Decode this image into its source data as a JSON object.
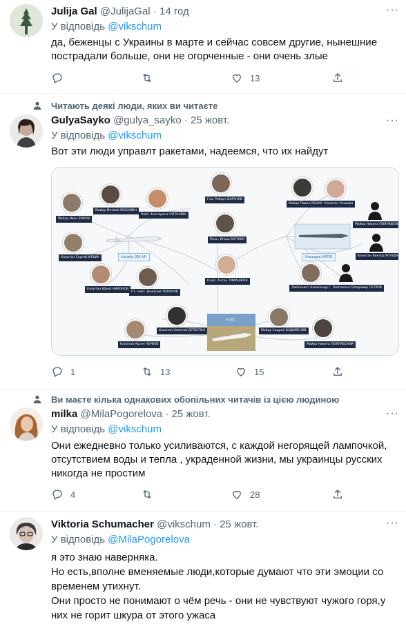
{
  "tweets": {
    "t1": {
      "name": "Julija Gal",
      "handle": "@JulijaGal",
      "date": "14 год",
      "reply_prefix": "У відповідь",
      "reply_to": "@vikschum",
      "lines": [
        "да, беженцы с Украины в марте и сейчас совсем другие, нынешние",
        "пострадали больше, они не огорченные - они очень злые"
      ],
      "replies": "",
      "retweets": "",
      "likes": "13"
    },
    "t2": {
      "social_context": "Читають деякі люди, яких ви читаєте",
      "name": "GulyaSayko",
      "handle": "@gulya_sayko",
      "date": "25 жовт.",
      "reply_prefix": "У відповідь",
      "reply_to": "@vikschum",
      "lines": [
        "Вот эти люди управлт ракетами, надеемся, что их найдут"
      ],
      "replies": "1",
      "retweets": "13",
      "likes": "15"
    },
    "t3": {
      "social_context": "Ви маєте кілька однакових обопільних читачів із цією людиною",
      "name": "milka",
      "handle": "@MilaPogorelova",
      "date": "25 жовт.",
      "reply_prefix": "У відповідь",
      "reply_to": "@vikschum",
      "lines": [
        "Они ежедневно только усиливаются, с каждой негорящей лампочкой,",
        "отсутствием воды и тепла , украденной жизни, мы украинцы русских",
        "никогда не простим"
      ],
      "replies": "4",
      "retweets": "",
      "likes": "28"
    },
    "t4": {
      "name": "Viktoria Schumacher",
      "handle": "@vikschum",
      "date": "25 жовт.",
      "reply_prefix": "У відповідь",
      "reply_to": "@MilaPogorelova",
      "lines": [
        "я это знаю наверняка.",
        "Но есть,вполне  вменяемые люди,которые думают что эти эмоции со",
        "временем утихнут.",
        "Они просто не понимают о чём речь - они не чувствуют чужого горя,у",
        "них не горит шкура от этого ужаса"
      ]
    }
  },
  "separator": "·",
  "more_label": "···",
  "media": {
    "labels": [
      "Майор Иван ВЛКОВ",
      "Майор Матвей ЛЮБАВИН",
      "Лейт. Екатерина ЧУГУНОВА",
      "Гла. Роберт БАРАНОВ",
      "Майор Павел ОБУХОВ",
      "Капитан Эльвира",
      "Майор Никита ПОЯЛАВСКИЙ",
      "Капитан Сергей ИЛЬИН",
      "Калибр (3М-14)",
      "Полк. Игорь БАГНЮК",
      "Капитан Виктор ЯСКУДАЙНЕН",
      "Капитан Юрий НИКОНОВ",
      "Ст. лейт. Дмитрий ТИХОНОВ",
      "Подп. Антон ТИМАШКОВ",
      "Искандер 9М728",
      "Лейтенант Александр ГРИГОРЬЕВ",
      "Лейтенант Владимир ПЕТРОВ",
      "Капитан Алексей БЕТЕКТИН",
      "Х-101",
      "Майор Андрей ВАДИМЕНОВ",
      "Капитан Арсен ЧЕРВОВ",
      "Майор Никита ПОЯЛАВСКИЙ"
    ]
  },
  "colors": {
    "accent": "#1d9bf0",
    "muted": "#536471",
    "text": "#0f1419",
    "label_bg": "#1f2a44"
  }
}
